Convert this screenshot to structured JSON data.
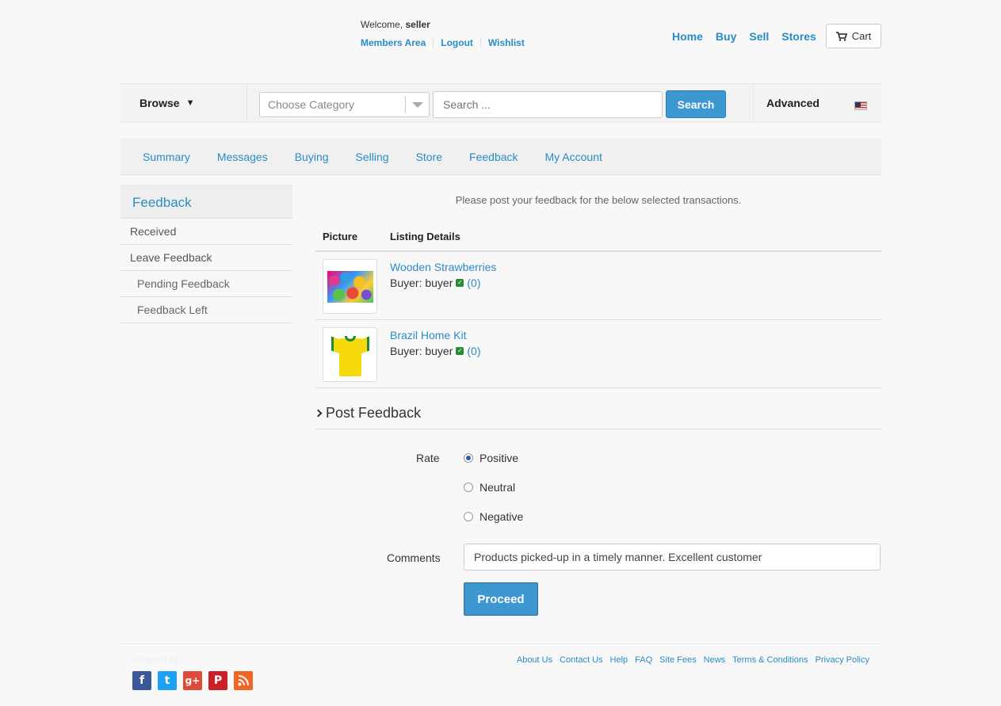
{
  "header": {
    "welcome_prefix": "Welcome,",
    "username": "seller",
    "member_links": [
      "Members Area",
      "Logout",
      "Wishlist"
    ],
    "nav": [
      "Home",
      "Buy",
      "Sell",
      "Stores"
    ],
    "cart_label": "Cart"
  },
  "search": {
    "browse_label": "Browse",
    "category_placeholder": "Choose Category",
    "search_placeholder": "Search ...",
    "search_button": "Search",
    "advanced_label": "Advanced"
  },
  "tabs": [
    "Summary",
    "Messages",
    "Buying",
    "Selling",
    "Store",
    "Feedback",
    "My Account"
  ],
  "sidebar": {
    "title": "Feedback",
    "items": [
      "Received",
      "Leave Feedback"
    ],
    "subitems": [
      "Pending Feedback",
      "Feedback Left"
    ]
  },
  "main": {
    "intro": "Please post your feedback for the below selected transactions.",
    "col_picture": "Picture",
    "col_details": "Listing Details",
    "listings": [
      {
        "title": "Wooden Strawberries",
        "buyer_label": "Buyer: buyer",
        "score": "(0)"
      },
      {
        "title": "Brazil Home Kit",
        "buyer_label": "Buyer: buyer",
        "score": "(0)"
      }
    ],
    "post_heading": "Post Feedback",
    "rate_label": "Rate",
    "rate_options": [
      "Positive",
      "Neutral",
      "Negative"
    ],
    "selected_rate": "Positive",
    "comments_label": "Comments",
    "comments_value": "Products picked-up in a timely manner. Excellent customer",
    "proceed_button": "Proceed"
  },
  "footer": {
    "powered": "Powered by",
    "links": [
      "About Us",
      "Contact Us",
      "Help",
      "FAQ",
      "Site Fees",
      "News",
      "Terms & Conditions",
      "Privacy Policy"
    ],
    "social_colors": {
      "facebook": "#3b5998",
      "twitter": "#1da1f2",
      "googleplus": "#dd4b39",
      "pinterest": "#cb2027",
      "rss": "#f26522"
    }
  }
}
